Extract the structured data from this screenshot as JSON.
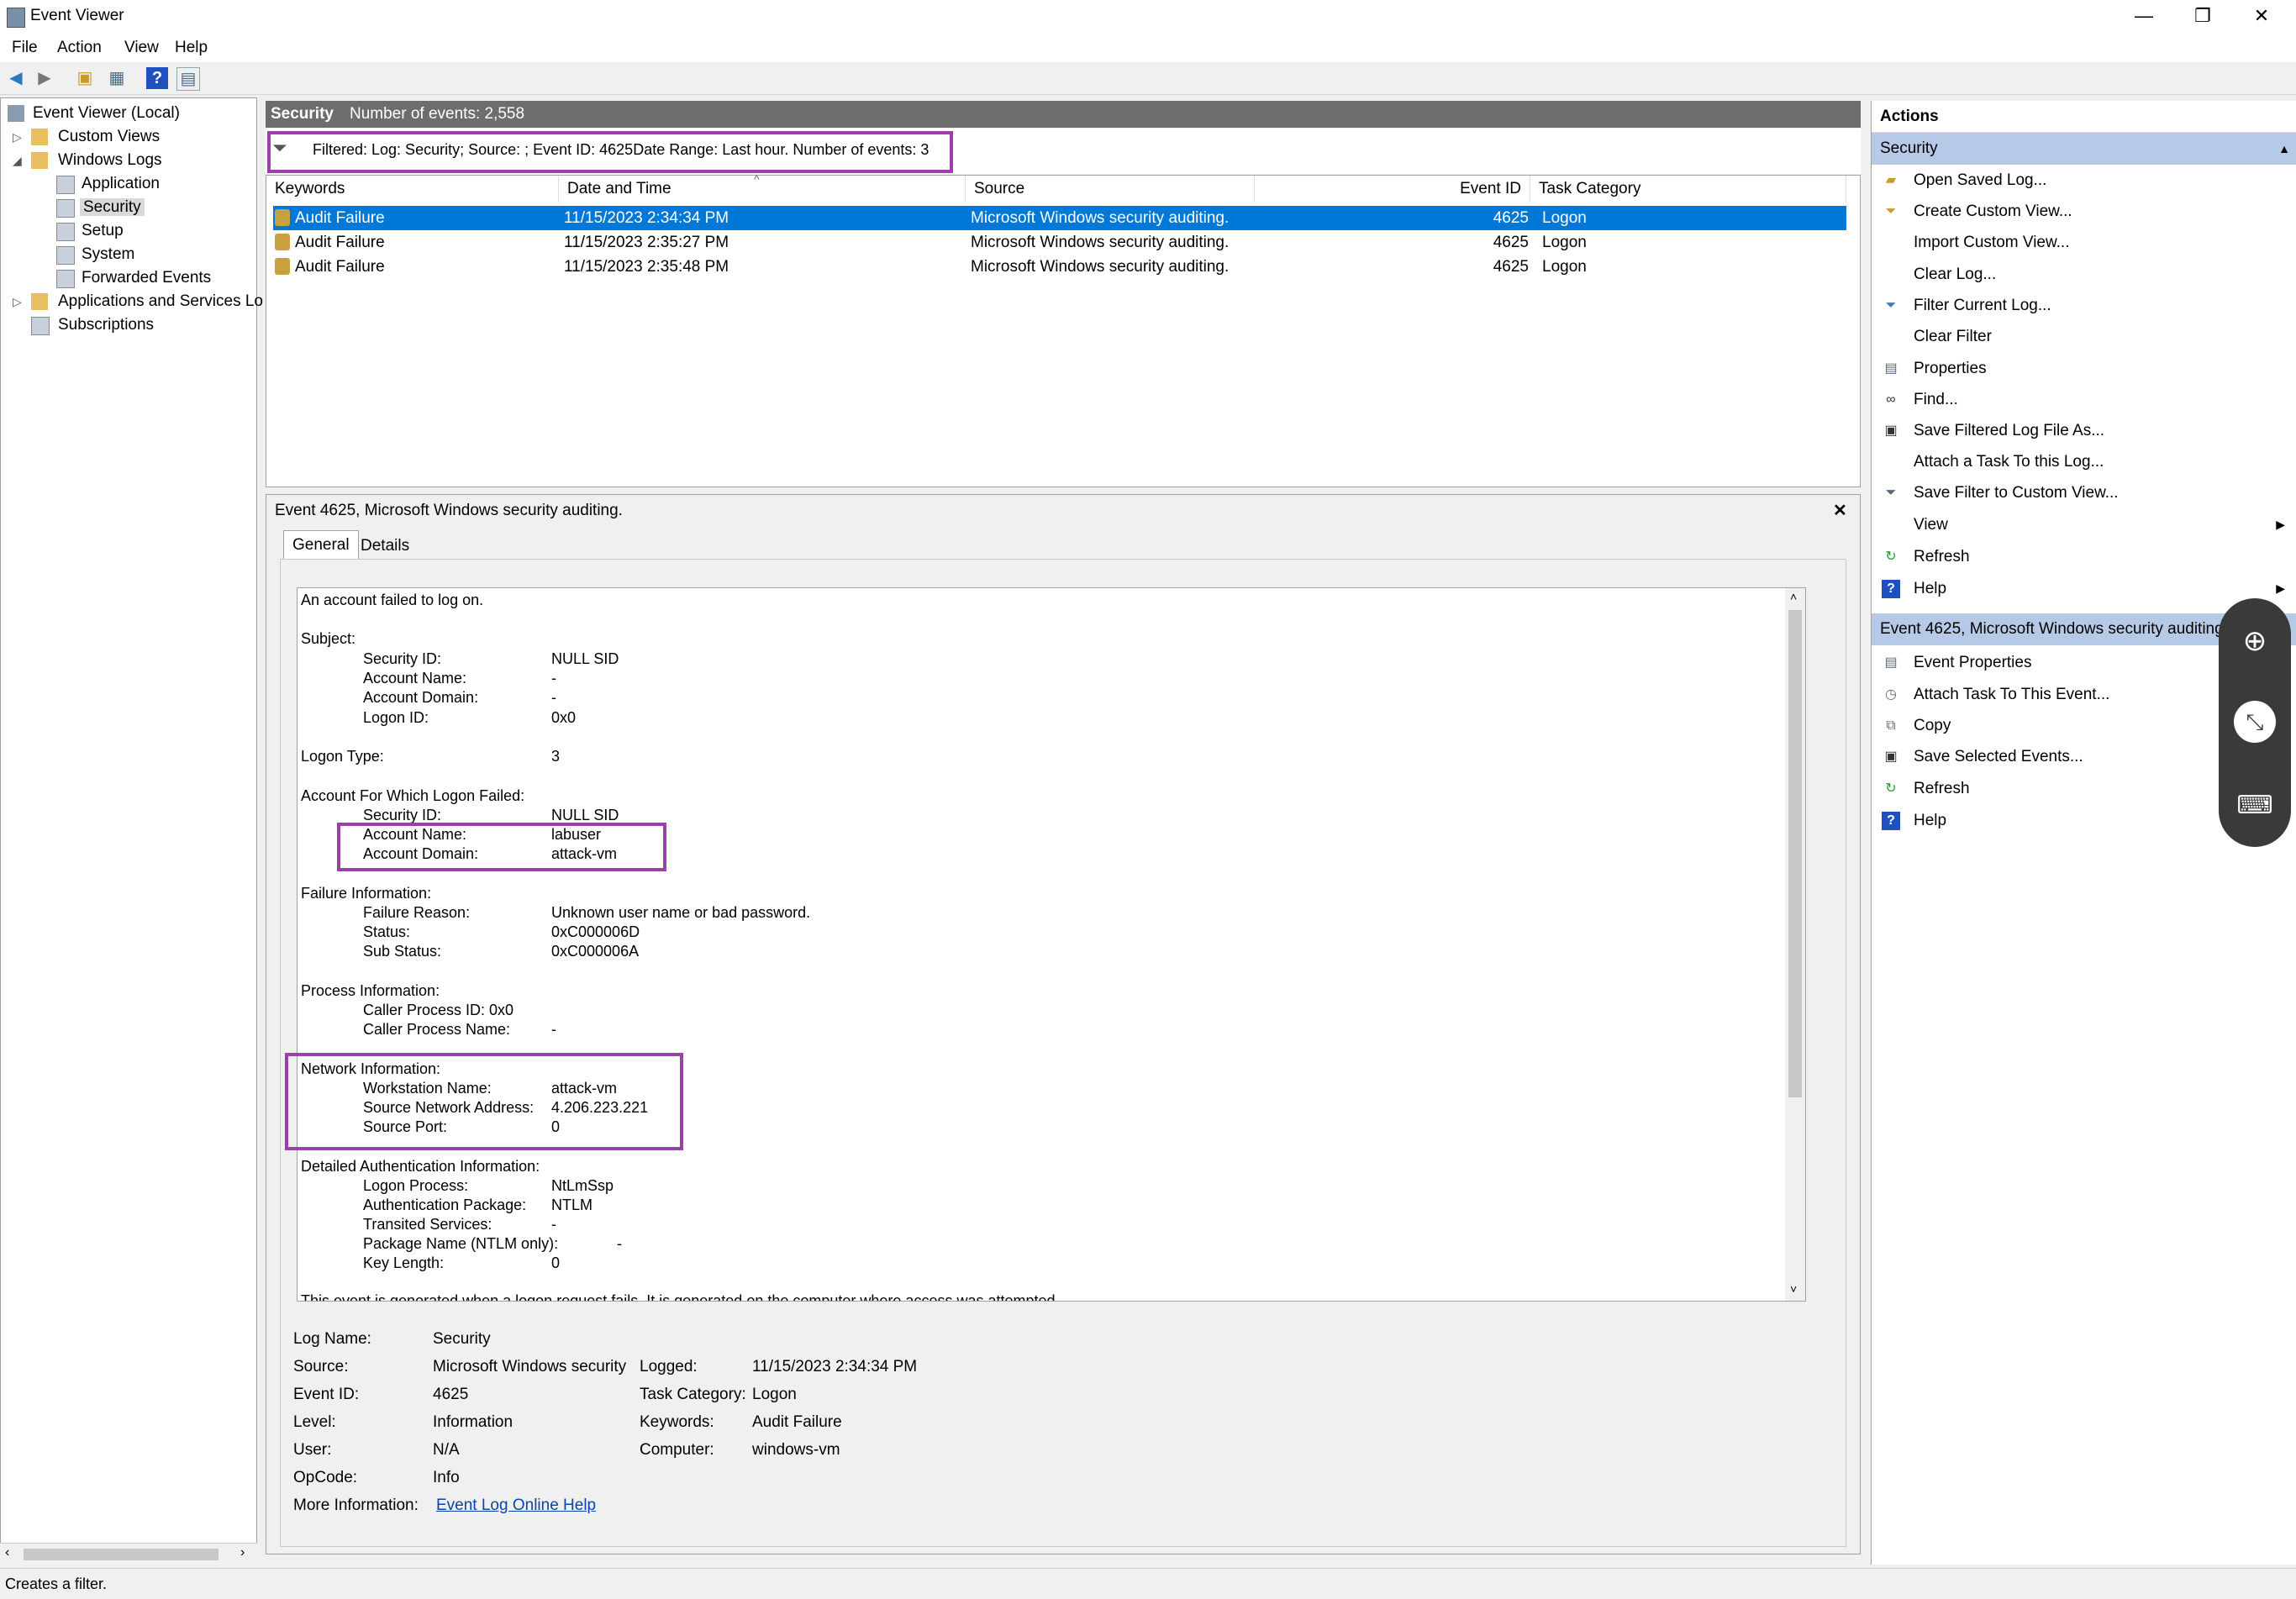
{
  "window": {
    "title": "Event Viewer",
    "minimize": "—",
    "restore": "❐",
    "close": "✕"
  },
  "menu": [
    "File",
    "Action",
    "View",
    "Help"
  ],
  "tree": {
    "root": "Event Viewer (Local)",
    "custom_views": "Custom Views",
    "windows_logs": "Windows Logs",
    "application": "Application",
    "security": "Security",
    "setup": "Setup",
    "system": "System",
    "forwarded": "Forwarded Events",
    "apps_services": "Applications and Services Lo",
    "subscriptions": "Subscriptions"
  },
  "log_header": {
    "name": "Security",
    "count": "Number of events: 2,558"
  },
  "filter_text": "Filtered: Log: Security; Source: ; Event ID: 4625Date Range: Last hour. Number of events: 3",
  "columns": [
    "Keywords",
    "Date and Time",
    "Source",
    "Event ID",
    "Task Category"
  ],
  "events": [
    {
      "keywords": "Audit Failure",
      "date": "11/15/2023 2:34:34 PM",
      "source": "Microsoft Windows security auditing.",
      "id": "4625",
      "category": "Logon"
    },
    {
      "keywords": "Audit Failure",
      "date": "11/15/2023 2:35:27 PM",
      "source": "Microsoft Windows security auditing.",
      "id": "4625",
      "category": "Logon"
    },
    {
      "keywords": "Audit Failure",
      "date": "11/15/2023 2:35:48 PM",
      "source": "Microsoft Windows security auditing.",
      "id": "4625",
      "category": "Logon"
    }
  ],
  "detail": {
    "title": "Event 4625, Microsoft Windows security auditing.",
    "close": "✕",
    "tabs": [
      "General",
      "Details"
    ],
    "text": {
      "intro": "An account failed to log on.",
      "subject": "Subject:",
      "subj_sid_l": "Security ID:",
      "subj_sid_v": "NULL SID",
      "subj_name_l": "Account Name:",
      "subj_name_v": "-",
      "subj_dom_l": "Account Domain:",
      "subj_dom_v": "-",
      "subj_logon_l": "Logon ID:",
      "subj_logon_v": "0x0",
      "logon_type_l": "Logon Type:",
      "logon_type_v": "3",
      "acct_failed": "Account For Which Logon Failed:",
      "af_sid_l": "Security ID:",
      "af_sid_v": "NULL SID",
      "af_name_l": "Account Name:",
      "af_name_v": "labuser",
      "af_dom_l": "Account Domain:",
      "af_dom_v": "attack-vm",
      "failure": "Failure Information:",
      "fr_l": "Failure Reason:",
      "fr_v": "Unknown user name or bad password.",
      "st_l": "Status:",
      "st_v": "0xC000006D",
      "sst_l": "Sub Status:",
      "sst_v": "0xC000006A",
      "process": "Process Information:",
      "cpid_l": "Caller Process ID:",
      "cpid_v": "0x0",
      "cpn_l": "Caller Process Name:",
      "cpn_v": "-",
      "network": "Network Information:",
      "ws_l": "Workstation Name:",
      "ws_v": "attack-vm",
      "sna_l": "Source Network Address:",
      "sna_v": "4.206.223.221",
      "sp_l": "Source Port:",
      "sp_v": "0",
      "auth": "Detailed Authentication Information:",
      "lp_l": "Logon Process:",
      "lp_v": "NtLmSsp",
      "ap_l": "Authentication Package:",
      "ap_v": "NTLM",
      "ts_l": "Transited Services:",
      "ts_v": "-",
      "pn_l": "Package Name (NTLM only):",
      "pn_v": "-",
      "kl_l": "Key Length:",
      "kl_v": "0",
      "footer": "This event is generated when a logon request fails. It is generated on the computer where access was attempted."
    },
    "props": {
      "log_name_l": "Log Name:",
      "log_name_v": "Security",
      "source_l": "Source:",
      "source_v": "Microsoft Windows security",
      "logged_l": "Logged:",
      "logged_v": "11/15/2023 2:34:34 PM",
      "event_id_l": "Event ID:",
      "event_id_v": "4625",
      "task_l": "Task Category:",
      "task_v": "Logon",
      "level_l": "Level:",
      "level_v": "Information",
      "keywords_l": "Keywords:",
      "keywords_v": "Audit Failure",
      "user_l": "User:",
      "user_v": "N/A",
      "computer_l": "Computer:",
      "computer_v": "windows-vm",
      "opcode_l": "OpCode:",
      "opcode_v": "Info",
      "more_l": "More Information:",
      "more_link": "Event Log Online Help"
    }
  },
  "actions": {
    "title": "Actions",
    "section1": "Security",
    "items1": [
      "Open Saved Log...",
      "Create Custom View...",
      "Import Custom View...",
      "Clear Log...",
      "Filter Current Log...",
      "Clear Filter",
      "Properties",
      "Find...",
      "Save Filtered Log File As...",
      "Attach a Task To this Log...",
      "Save Filter to Custom View...",
      "View",
      "Refresh",
      "Help"
    ],
    "section2": "Event 4625, Microsoft Windows security auditing.",
    "items2": [
      "Event Properties",
      "Attach Task To This Event...",
      "Copy",
      "Save Selected Events...",
      "Refresh",
      "Help"
    ]
  },
  "status_text": "Creates a filter."
}
